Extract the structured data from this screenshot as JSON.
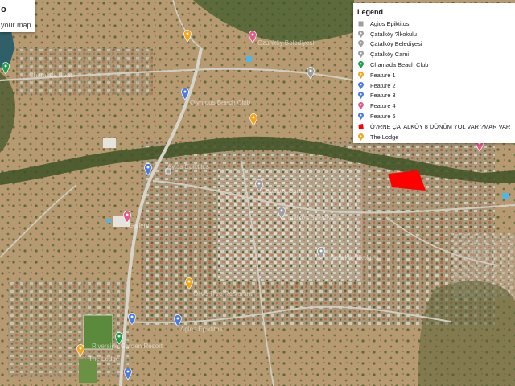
{
  "map_info": {
    "title": "o",
    "subtitle": "your map"
  },
  "legend": {
    "title": "Legend",
    "items": [
      {
        "label": "Agios Epiktitos",
        "icon": "square-marker-icon",
        "color": "#9e9e9e"
      },
      {
        "label": "Çatalköy ?lkokulu",
        "icon": "pin-icon",
        "color": "#9e9e9e"
      },
      {
        "label": "Çatalköy Belediyesi",
        "icon": "pin-icon",
        "color": "#9e9e9e"
      },
      {
        "label": "Çatalköy Cami",
        "icon": "pin-icon",
        "color": "#9e9e9e"
      },
      {
        "label": "Chamada Beach Club",
        "icon": "pin-icon",
        "color": "#1e9e4a"
      },
      {
        "label": "Feature 1",
        "icon": "pin-icon",
        "color": "#f2a51a"
      },
      {
        "label": "Feature 2",
        "icon": "pin-icon",
        "color": "#4a7be0"
      },
      {
        "label": "Feature 3",
        "icon": "pin-icon",
        "color": "#4a7be0"
      },
      {
        "label": "Feature 4",
        "icon": "pin-icon",
        "color": "#e05a8a"
      },
      {
        "label": "Feature 5",
        "icon": "pin-icon",
        "color": "#4a7be0"
      },
      {
        "label": "Ö?RNE ÇATALKÖY 8 DÖNÜM YOL VAR ?MAR VAR",
        "icon": "polygon-icon",
        "color": "#ff0000"
      },
      {
        "label": "The Lodge",
        "icon": "pin-icon",
        "color": "#f2a51a"
      }
    ]
  },
  "map": {
    "area_color": "#ff0000",
    "poi_labels": [
      "Chamada Beach",
      "Ozanköy Belediyesi",
      "Catalkoy Belediyesi",
      "Çatalköy Ilkokulu",
      "Ayios Epiktitos",
      "Catalkoy Cami",
      "Olive Tree Restorant",
      "Gallery",
      "Olympus Beach Club",
      "Agios Epiktitos",
      "Riverside Garden Resort",
      "The Lodge"
    ]
  }
}
